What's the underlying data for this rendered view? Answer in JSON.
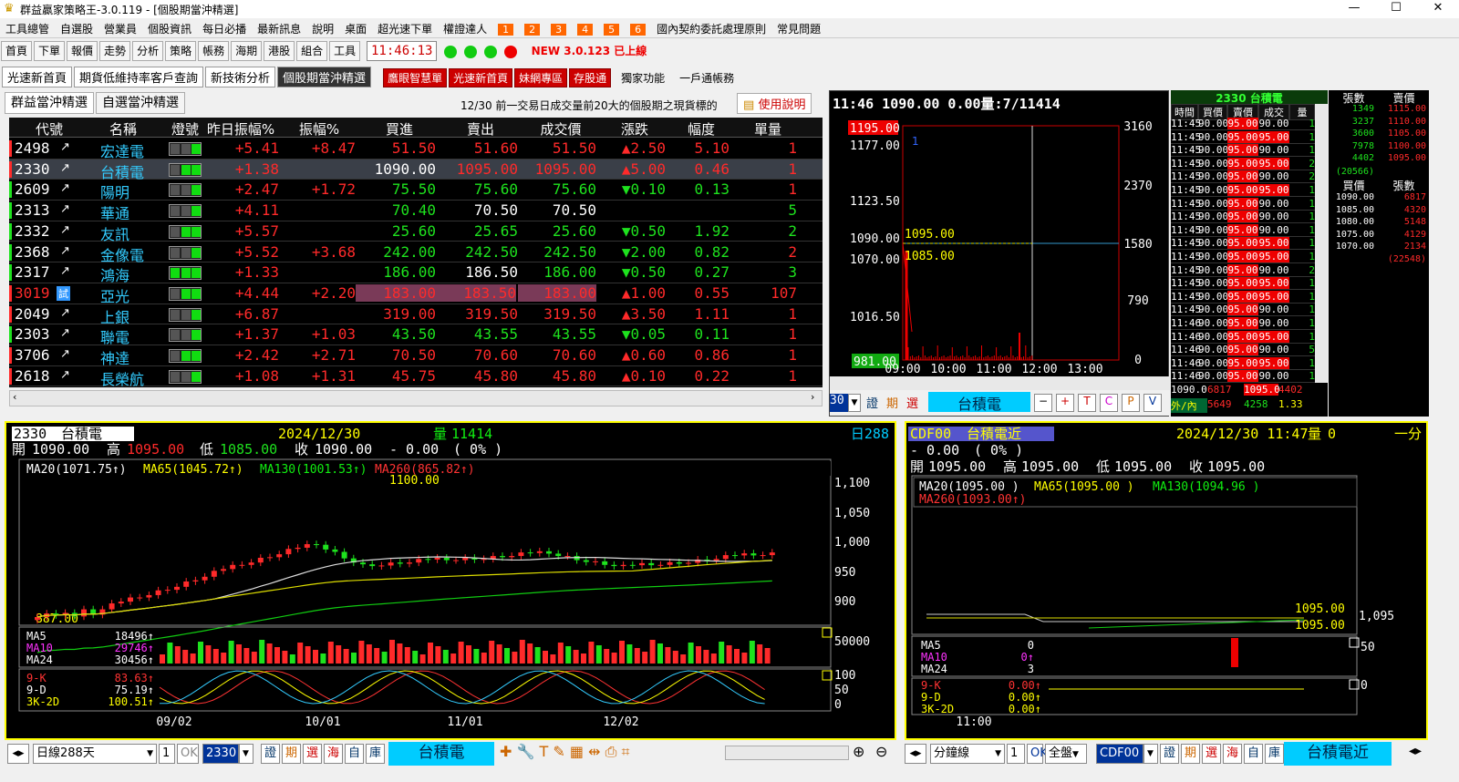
{
  "window": {
    "title": "群益贏家策略王-3.0.119 - [個股期當沖精選]"
  },
  "menu": [
    "工具總管",
    "自選股",
    "營業員",
    "個股資訊",
    "每日必播",
    "最新訊息",
    "說明",
    "桌面",
    "超光速下單",
    "權證達人",
    "1",
    "2",
    "3",
    "4",
    "5",
    "6",
    "國內契約委託處理原則",
    "常見問題"
  ],
  "toolbar": {
    "items": [
      "首頁",
      "下單",
      "報價",
      "走勢",
      "分析",
      "策略",
      "帳務",
      "海期",
      "港股",
      "組合",
      "工具"
    ],
    "clock": "11:46:13",
    "new_label": "NEW 3.0.123 已上線"
  },
  "tabs2": [
    "光速新首頁",
    "期貨低維持率客戶查詢",
    "新技術分析",
    "個股期當沖精選"
  ],
  "tabs2_red": [
    "鷹眼智慧單",
    "光速新首頁",
    "妹網專區",
    "存股通"
  ],
  "tabs2_plain": [
    "獨家功能",
    "一戶通帳務"
  ],
  "panel": {
    "tab1": "群益當沖精選",
    "tab2": "自選當沖精選",
    "note": "12/30 前一交易日成交量前20大的個股期之現貨標的",
    "help": "使用說明"
  },
  "grid": {
    "headers": [
      "代號",
      "名稱",
      "燈號",
      "昨日振幅%",
      "振幅%",
      "買進",
      "賣出",
      "成交價",
      "漲跌",
      "幅度",
      "單量"
    ],
    "rows": [
      {
        "code": "2498",
        "name": "宏達電",
        "amp_y": "+5.41",
        "amp": "+8.47",
        "bid": "51.50",
        "ask": "51.60",
        "last": "51.50",
        "chg": "▲2.50",
        "pct": "5.10",
        "vol": "1",
        "up": true
      },
      {
        "code": "2330",
        "name": "台積電",
        "amp_y": "+1.38",
        "amp": "",
        "bid": "1090.00",
        "ask": "1095.00",
        "last": "1095.00",
        "chg": "▲5.00",
        "pct": "0.46",
        "vol": "1",
        "up": true
      },
      {
        "code": "2609",
        "name": "陽明",
        "amp_y": "+2.47",
        "amp": "+1.72",
        "bid": "75.50",
        "ask": "75.60",
        "last": "75.60",
        "chg": "▼0.10",
        "pct": "0.13",
        "vol": "1",
        "up": false
      },
      {
        "code": "2313",
        "name": "華通",
        "amp_y": "+4.11",
        "amp": "",
        "bid": "70.40",
        "ask": "70.50",
        "last": "70.50",
        "chg": "",
        "pct": "",
        "vol": "5",
        "up": null
      },
      {
        "code": "2332",
        "name": "友訊",
        "amp_y": "+5.57",
        "amp": "",
        "bid": "25.60",
        "ask": "25.65",
        "last": "25.60",
        "chg": "▼0.50",
        "pct": "1.92",
        "vol": "2",
        "up": false
      },
      {
        "code": "2368",
        "name": "金像電",
        "amp_y": "+5.52",
        "amp": "+3.68",
        "bid": "242.00",
        "ask": "242.50",
        "last": "242.50",
        "chg": "▼2.00",
        "pct": "0.82",
        "vol": "2",
        "up": false
      },
      {
        "code": "2317",
        "name": "鴻海",
        "amp_y": "+1.33",
        "amp": "",
        "bid": "186.00",
        "ask": "186.50",
        "last": "186.00",
        "chg": "▼0.50",
        "pct": "0.27",
        "vol": "3",
        "up": false
      },
      {
        "code": "3019",
        "name": "亞光",
        "amp_y": "+4.44",
        "amp": "+2.20",
        "bid": "183.00",
        "ask": "183.50",
        "last": "183.00",
        "chg": "▲1.00",
        "pct": "0.55",
        "vol": "107",
        "up": true
      },
      {
        "code": "2049",
        "name": "上銀",
        "amp_y": "+6.87",
        "amp": "",
        "bid": "319.00",
        "ask": "319.50",
        "last": "319.50",
        "chg": "▲3.50",
        "pct": "1.11",
        "vol": "1",
        "up": true
      },
      {
        "code": "2303",
        "name": "聯電",
        "amp_y": "+1.37",
        "amp": "+1.03",
        "bid": "43.50",
        "ask": "43.55",
        "last": "43.55",
        "chg": "▼0.05",
        "pct": "0.11",
        "vol": "1",
        "up": false
      },
      {
        "code": "3706",
        "name": "神達",
        "amp_y": "+2.42",
        "amp": "+2.71",
        "bid": "70.50",
        "ask": "70.60",
        "last": "70.60",
        "chg": "▲0.60",
        "pct": "0.86",
        "vol": "1",
        "up": true
      },
      {
        "code": "2618",
        "name": "長榮航",
        "amp_y": "+1.08",
        "amp": "+1.31",
        "bid": "45.75",
        "ask": "45.80",
        "last": "45.80",
        "chg": "▲0.10",
        "pct": "0.22",
        "vol": "1",
        "up": true
      }
    ]
  },
  "tick": {
    "header": "11:46  1090.00  0.00量:7/11414",
    "price_hi": "1195.00",
    "price_lo": "981.00",
    "y_left": [
      "1177.00",
      "1123.50",
      "1090.00",
      "1070.00",
      "1016.50"
    ],
    "y_right": [
      "3160",
      "2370",
      "1580",
      "790",
      "0"
    ],
    "x": [
      "09:00",
      "10:00",
      "11:00",
      "12:00",
      "13:00"
    ],
    "lbl_hi": "1095.00",
    "lbl_lo": "1085.00",
    "marker": "1",
    "stock": "台積電",
    "code": "30"
  },
  "ticklist": {
    "title": "2330 台積電",
    "headers": [
      "時間",
      "買價",
      "賣價",
      "成交",
      "量"
    ],
    "rows": [
      [
        "11:45",
        "90.00",
        "95.00",
        "90.00",
        "1"
      ],
      [
        "11:45",
        "90.00",
        "95.00",
        "95.00",
        "1"
      ],
      [
        "11:45",
        "90.00",
        "95.00",
        "90.00",
        "1"
      ],
      [
        "11:45",
        "90.00",
        "95.00",
        "95.00",
        "2"
      ],
      [
        "11:45",
        "90.00",
        "95.00",
        "90.00",
        "2"
      ],
      [
        "11:45",
        "90.00",
        "95.00",
        "95.00",
        "1"
      ],
      [
        "11:45",
        "90.00",
        "95.00",
        "90.00",
        "1"
      ],
      [
        "11:45",
        "90.00",
        "95.00",
        "90.00",
        "1"
      ],
      [
        "11:45",
        "90.00",
        "95.00",
        "90.00",
        "1"
      ],
      [
        "11:45",
        "90.00",
        "95.00",
        "95.00",
        "1"
      ],
      [
        "11:45",
        "90.00",
        "95.00",
        "95.00",
        "1"
      ],
      [
        "11:45",
        "90.00",
        "95.00",
        "90.00",
        "2"
      ],
      [
        "11:45",
        "90.00",
        "95.00",
        "95.00",
        "1"
      ],
      [
        "11:45",
        "90.00",
        "95.00",
        "95.00",
        "1"
      ],
      [
        "11:45",
        "90.00",
        "95.00",
        "90.00",
        "1"
      ],
      [
        "11:46",
        "90.00",
        "95.00",
        "90.00",
        "1"
      ],
      [
        "11:46",
        "90.00",
        "95.00",
        "95.00",
        "1"
      ],
      [
        "11:46",
        "90.00",
        "95.00",
        "90.00",
        "5"
      ],
      [
        "11:46",
        "90.00",
        "95.00",
        "95.00",
        "1"
      ],
      [
        "11:46",
        "90.00",
        "95.00",
        "90.00",
        "1"
      ]
    ],
    "foot1": [
      "1090.0",
      "6817",
      "1095.0",
      "4402"
    ],
    "foot2": [
      "外/內",
      "5649",
      "4258",
      "1.33"
    ]
  },
  "depth": {
    "headers": [
      "張數",
      "賣價"
    ],
    "asks": [
      [
        "1349",
        "1115.00"
      ],
      [
        "3237",
        "1110.00"
      ],
      [
        "3600",
        "1105.00"
      ],
      [
        "7978",
        "1100.00"
      ],
      [
        "4402",
        "1095.00"
      ]
    ],
    "ask_total": "(20566)",
    "headers2": [
      "買價",
      "張數"
    ],
    "bids": [
      [
        "1090.00",
        "6817"
      ],
      [
        "1085.00",
        "4320"
      ],
      [
        "1080.00",
        "5148"
      ],
      [
        "1075.00",
        "4129"
      ],
      [
        "1070.00",
        "2134"
      ]
    ],
    "bid_total": "(22548)"
  },
  "main": {
    "code": "2330",
    "name": "台積電",
    "date": "2024/12/30",
    "vol_label": "量",
    "vol": "11414",
    "period": "日288",
    "ohlc": {
      "o_l": "開",
      "o": "1090.00",
      "h_l": "高",
      "h": "1095.00",
      "l_l": "低",
      "l": "1085.00",
      "c_l": "收",
      "c": "1090.00",
      "chg": "- 0.00",
      "pct": "( 0% )"
    },
    "ma": [
      "MA20(1071.75↑)",
      "MA65(1045.72↑)",
      "MA130(1001.53↑)",
      "MA260(865.82↑)"
    ],
    "hi_lbl": "1100.00",
    "lo_lbl": "887.00",
    "y": [
      "1,100",
      "1,050",
      "1,000",
      "950",
      "900"
    ],
    "vol_ma": [
      [
        "MA5",
        "18496↑"
      ],
      [
        "MA10",
        "29746↑"
      ],
      [
        "MA24",
        "30456↑"
      ]
    ],
    "vol_y": "50000",
    "kd": [
      [
        "9-K",
        "83.63↑"
      ],
      [
        "9-D",
        "75.19↑"
      ],
      [
        "3K-2D",
        "100.51↑"
      ]
    ],
    "kd_y": [
      "100",
      "50",
      "0"
    ],
    "x": [
      "09/02",
      "10/01",
      "11/01",
      "12/02"
    ]
  },
  "sub": {
    "code": "CDF00",
    "name": "台積電近",
    "datetime": "2024/12/30 11:47",
    "vol_label": "量",
    "vol": "0",
    "period": "一分",
    "chg": "- 0.00",
    "pct": "( 0% )",
    "ohlc": [
      "開",
      "1095.00",
      "高",
      "1095.00",
      "低",
      "1095.00",
      "收",
      "1095.00"
    ],
    "ma": [
      "MA20(1095.00   )",
      "MA65(1095.00   )",
      "MA130(1094.96   )",
      "MA260(1093.00↑)"
    ],
    "lbl1": "1095.00",
    "lbl2": "1095.00",
    "y": "1,095",
    "vol_ma": [
      [
        "MA5",
        "0"
      ],
      [
        "MA10",
        "0↑"
      ],
      [
        "MA24",
        "3"
      ]
    ],
    "vol_y": "50",
    "kd": [
      [
        "9-K",
        "0.00↑"
      ],
      [
        "9-D",
        "0.00↑"
      ],
      [
        "3K-2D",
        "0.00↑"
      ]
    ],
    "kd_y": "0",
    "x": "11:00"
  },
  "bottom": {
    "period_main": "日線288天",
    "stock_main": "2330",
    "name_main": "台積電",
    "qty": "1",
    "ok": "OK",
    "period_sub": "分鐘線",
    "qty_sub": "1",
    "mode_sub": "全盤",
    "stock_sub": "CDF00",
    "name_sub": "台積電近",
    "btns": [
      "證",
      "期",
      "選",
      "海",
      "自",
      "庫"
    ]
  },
  "colors": {
    "up": "#ff2a2a",
    "down": "#1ee21e",
    "panel_border": "#ffff00",
    "accent": "#00ccff"
  }
}
